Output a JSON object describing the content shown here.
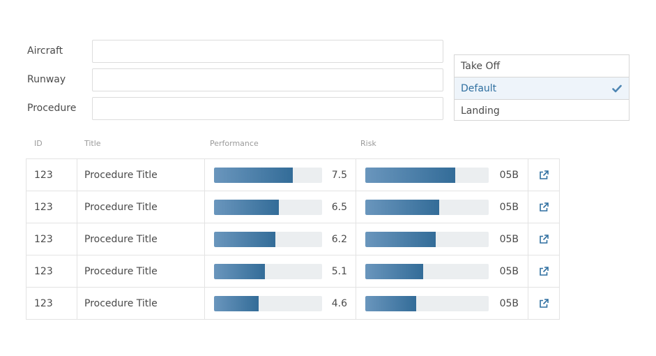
{
  "form": {
    "aircraft_label": "Aircraft",
    "aircraft_value": "",
    "runway_label": "Runway",
    "runway_value": "",
    "procedure_label": "Procedure",
    "procedure_value": ""
  },
  "phase_dropdown": {
    "options": [
      "Take Off",
      "Default",
      "Landing"
    ],
    "selected": "Default"
  },
  "table": {
    "headers": [
      "ID",
      "Title",
      "Performance",
      "Risk"
    ],
    "rows": [
      {
        "id": "123",
        "title": "Procedure Title",
        "performance": "7.5",
        "performance_fraction": 0.73,
        "risk": "05B",
        "risk_fraction": 0.73
      },
      {
        "id": "123",
        "title": "Procedure Title",
        "performance": "6.5",
        "performance_fraction": 0.6,
        "risk": "05B",
        "risk_fraction": 0.6
      },
      {
        "id": "123",
        "title": "Procedure Title",
        "performance": "6.2",
        "performance_fraction": 0.57,
        "risk": "05B",
        "risk_fraction": 0.57
      },
      {
        "id": "123",
        "title": "Procedure Title",
        "performance": "5.1",
        "performance_fraction": 0.47,
        "risk": "05B",
        "risk_fraction": 0.47
      },
      {
        "id": "123",
        "title": "Procedure Title",
        "performance": "4.6",
        "performance_fraction": 0.41,
        "risk": "05B",
        "risk_fraction": 0.41
      }
    ]
  },
  "icons": {
    "selected_check": "check-icon",
    "row_link": "external-link-icon"
  },
  "colors": {
    "accent": "#2f6fa0",
    "bar_start": "#6a96bd",
    "bar_end": "#336c98",
    "bar_track": "#ebeef0",
    "selected_bg": "#eef4fa"
  }
}
